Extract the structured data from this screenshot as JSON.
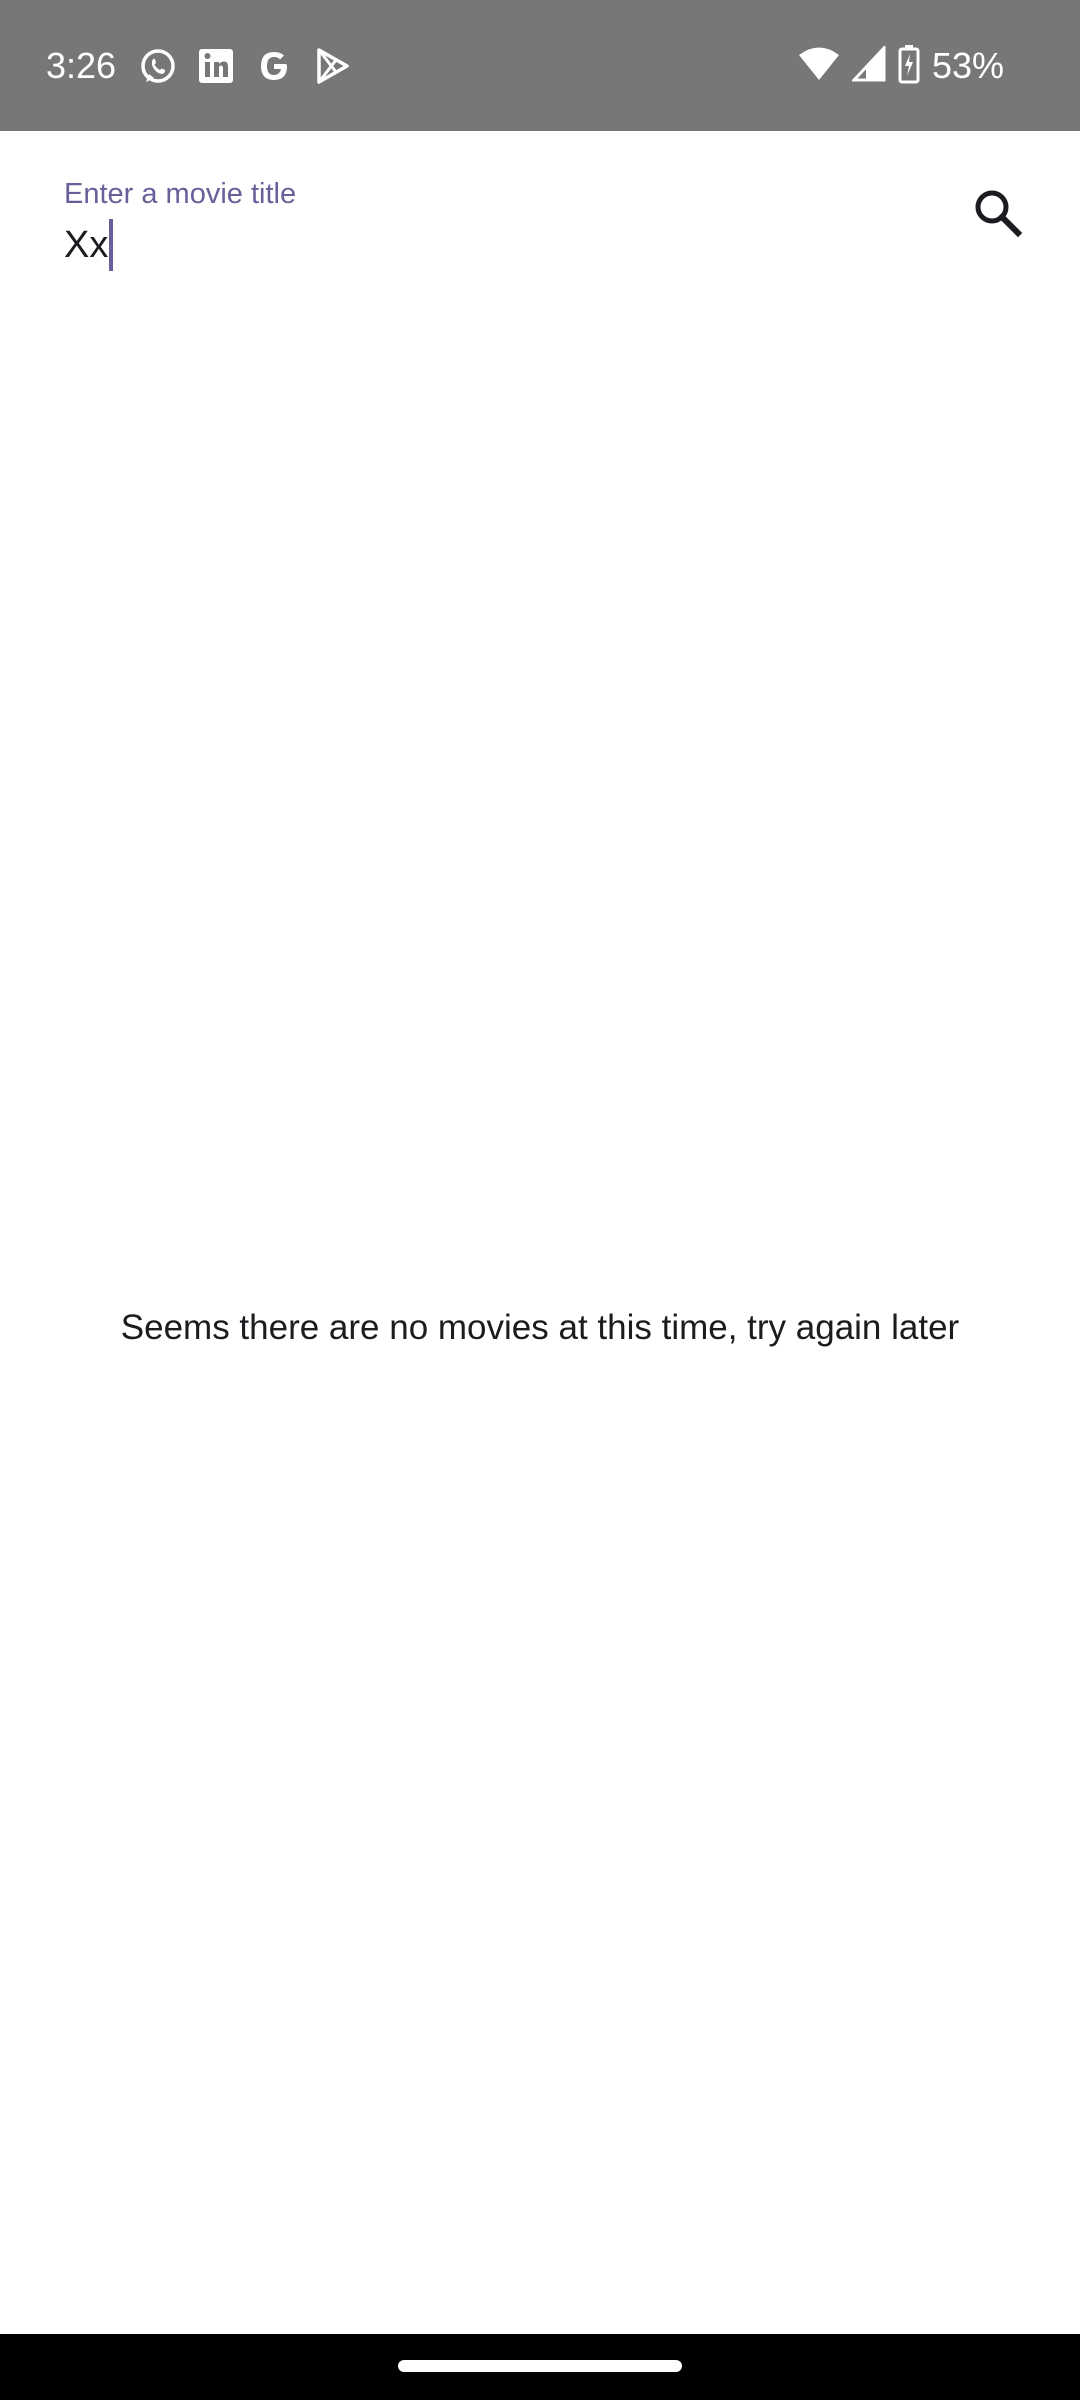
{
  "status_bar": {
    "time": "3:26",
    "notification_icons": [
      "whatsapp-icon",
      "linkedin-icon",
      "google-icon",
      "play-store-icon"
    ],
    "system_icons": [
      "wifi-icon",
      "cellular-signal-icon",
      "battery-charging-icon"
    ],
    "battery_percent": "53%"
  },
  "search": {
    "label": "Enter a movie title",
    "value": "Xx",
    "button_icon": "search-icon"
  },
  "main": {
    "empty_message": "Seems there are no movies at this time, try again later"
  },
  "colors": {
    "status_bar_bg": "#777777",
    "accent": "#6a5f9a",
    "text_primary": "#1c1b1f",
    "nav_bar_bg": "#000000"
  }
}
